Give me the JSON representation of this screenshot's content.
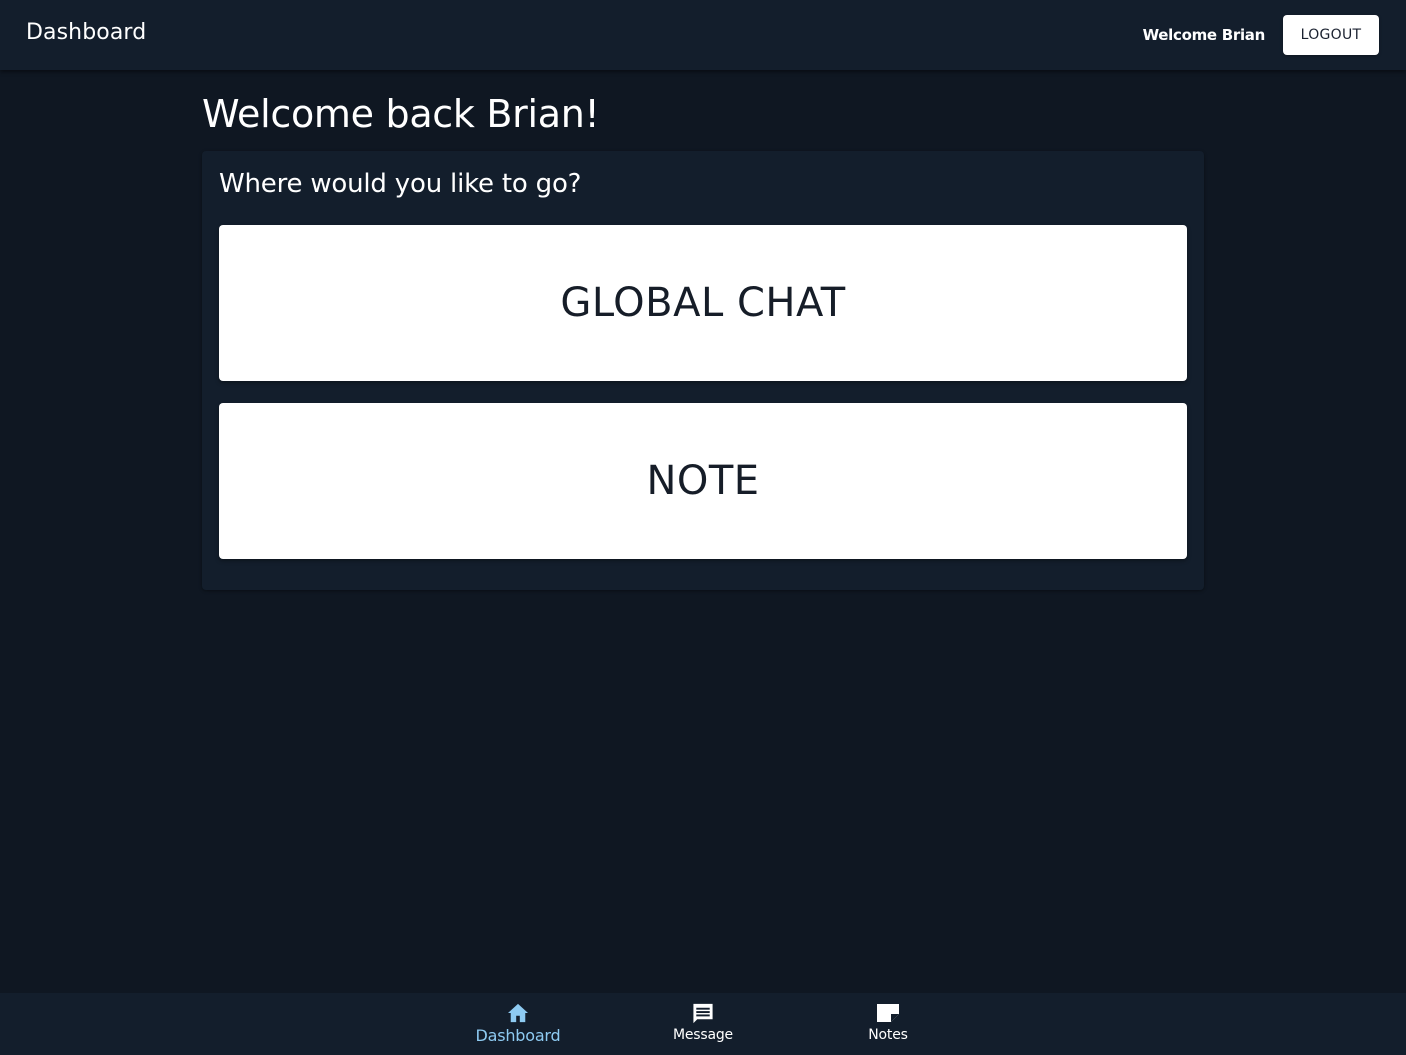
{
  "header": {
    "title": "Dashboard",
    "welcome_text": "Welcome Brian",
    "logout_label": "LOGOUT"
  },
  "main": {
    "heading": "Welcome back Brian!",
    "prompt": "Where would you like to go?",
    "tiles": [
      {
        "label": "GLOBAL CHAT"
      },
      {
        "label": "NOTE"
      }
    ]
  },
  "bottom_nav": {
    "active": "Dashboard",
    "items": [
      {
        "label": "Dashboard",
        "icon": "home-icon"
      },
      {
        "label": "Message",
        "icon": "message-icon"
      },
      {
        "label": "Notes",
        "icon": "note-icon"
      }
    ]
  },
  "colors": {
    "background": "#0f1722",
    "surface": "#131e2c",
    "active_accent": "#8ecbf2",
    "tile_text": "#161d28"
  }
}
